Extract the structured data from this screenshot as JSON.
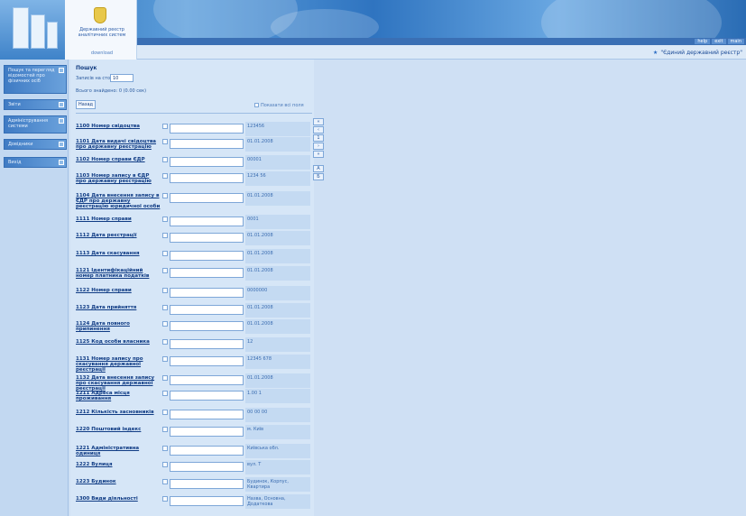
{
  "header": {
    "org_name": "Державний реєстр\nаналітичних систем",
    "org_sub": "download",
    "system_title": "\"Єдиний державний реєстр\"",
    "top_buttons": [
      "help",
      "exit",
      "main"
    ]
  },
  "sidebar": {
    "items": [
      {
        "label": "Пошук та перегляд відомостей про фізичних осіб"
      },
      {
        "label": "Звіти"
      },
      {
        "label": "Адміністрування системи"
      },
      {
        "label": "Довідники"
      },
      {
        "label": "Вихід"
      }
    ]
  },
  "page": {
    "breadcrumb": "Пошук",
    "records_label": "Записів на сторінці:",
    "records_value": "10",
    "found_label": "Всього знайдено: 0 (0.00 сек)",
    "back_button": "Назад",
    "show_all_label": "Показати всі поля"
  },
  "fields": [
    {
      "name": "1100 Номер свідоцтва",
      "value": "123456"
    },
    {
      "name": "1101 Дата видачі свідоцтва про державну реєстрацію",
      "value": "01.01.2008"
    },
    {
      "name": "1102 Номер справи ЄДР",
      "value": "00001"
    },
    {
      "name": "1103 Номер запису в ЄДР про державну реєстрацію",
      "value": "1234 56"
    },
    {
      "name": "1104 Дата внесення запису в ЄДР про державну реєстрацію юридичної особи",
      "value": "01.01.2008"
    },
    {
      "name": "1111 Номер справи",
      "value": "0001"
    },
    {
      "name": "1112 Дата реєстрації",
      "value": "01.01.2008"
    },
    {
      "name": "1113 Дата скасування",
      "value": "01.01.2008"
    },
    {
      "name": "1121 Ідентифікаційний номер платника податків",
      "value": "01.01.2008"
    },
    {
      "name": "1122 Номер справи",
      "value": "0000000"
    },
    {
      "name": "1123 Дата прийняття",
      "value": "01.01.2008"
    },
    {
      "name": "1124 Дата повного припинення",
      "value": "01.01.2008"
    },
    {
      "name": "1125 Код особи власника",
      "value": "12"
    },
    {
      "name": "1131 Номер запису про скасування державної реєстрації",
      "value": "12345 678"
    },
    {
      "name": "1132 Дата внесення запису про скасування державної реєстрації",
      "value": "01.01.2008"
    },
    {
      "name": "1211 Адреса місця проживання",
      "value": "1.00 1"
    },
    {
      "name": "1212 Кількість засновників",
      "value": "00 00 00"
    },
    {
      "name": "1220 Поштовий індекс",
      "value": "м. Київ"
    },
    {
      "name": "1221 Адміністративна одиниця",
      "value": "Київська обл."
    },
    {
      "name": "1222 Вулиця",
      "value": "вул. Т"
    },
    {
      "name": "1223 Будинок",
      "value": "Будинок, Корпус, Квартира"
    },
    {
      "name": "1300 Види діяльності",
      "value": "Назва, Основна, Додаткова"
    }
  ],
  "pager": [
    "«",
    "‹",
    "1",
    "›",
    "»",
    "A",
    "Б"
  ]
}
